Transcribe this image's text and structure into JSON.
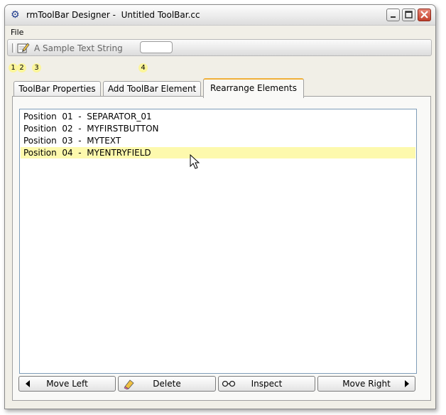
{
  "window": {
    "title": "rmToolBar Designer -  Untitled ToolBar.cc",
    "app_icon": "gear-icon"
  },
  "menu": {
    "file_label": "File"
  },
  "toolbar_preview": {
    "separator": "separator-icon",
    "button_icon": "pencil-note-icon",
    "text": "A Sample Text String",
    "entry_value": ""
  },
  "position_badges": [
    "1",
    "2",
    "3",
    "4"
  ],
  "tabs": [
    {
      "label": "ToolBar Properties"
    },
    {
      "label": "Add ToolBar Element"
    },
    {
      "label": "Rearrange Elements"
    }
  ],
  "active_tab": "Rearrange Elements",
  "elements_list": [
    {
      "text": "Position  01  -  SEPARATOR_01"
    },
    {
      "text": "Position  02  -  MYFIRSTBUTTON"
    },
    {
      "text": "Position  03  -  MYTEXT"
    },
    {
      "text": "Position  04  -  MYENTRYFIELD"
    }
  ],
  "selected_item": "Position  04  -  MYENTRYFIELD",
  "buttons": {
    "move_left": "Move Left",
    "delete": "Delete",
    "inspect": "Inspect",
    "move_right": "Move Right"
  },
  "colors": {
    "selection": "#fdf9ad",
    "active_tab_accent": "#f0b03a",
    "badge": "#fbf59a"
  }
}
